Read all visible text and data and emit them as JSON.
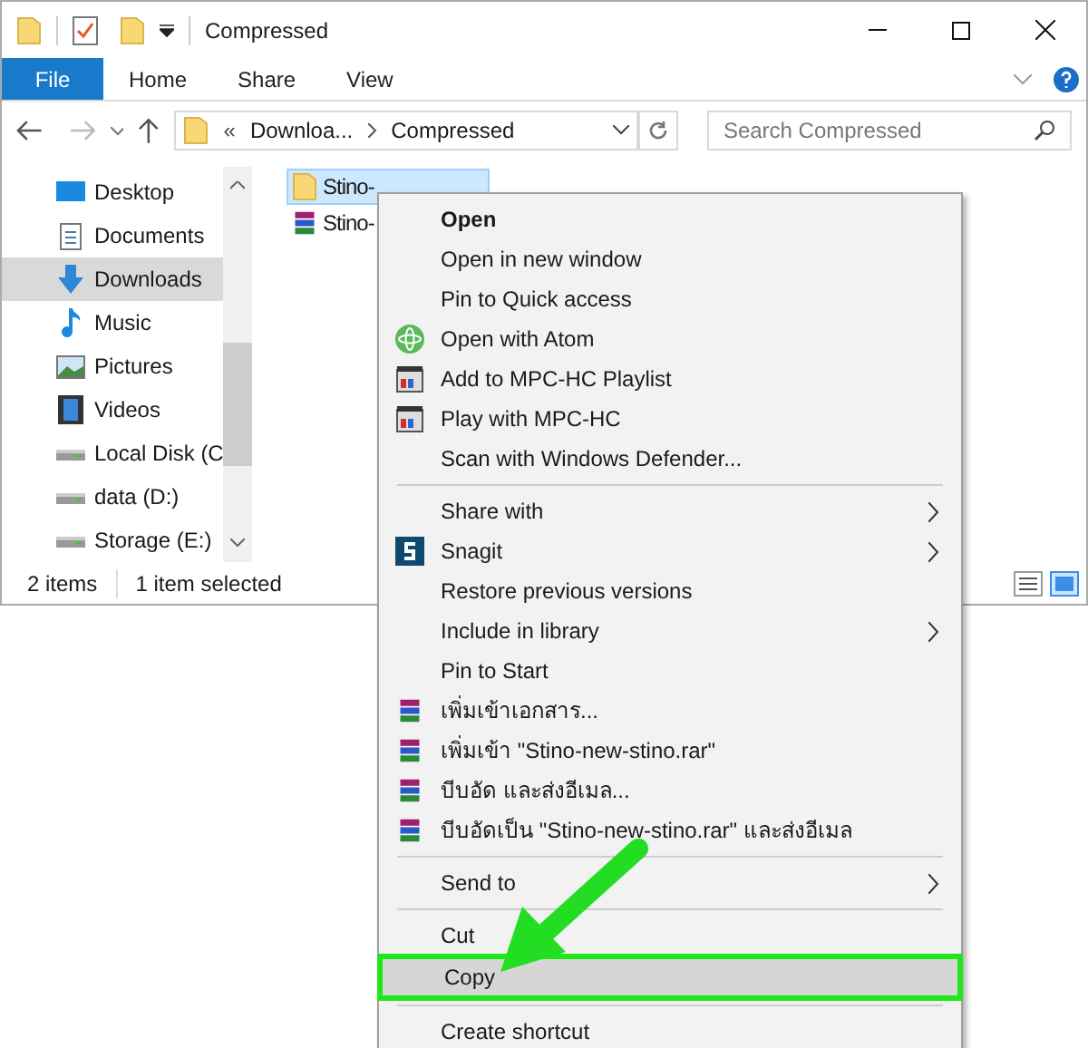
{
  "window": {
    "title": "Compressed"
  },
  "ribbon": {
    "tabs": [
      {
        "label": "File",
        "kind": "file"
      },
      {
        "label": "Home",
        "kind": "tab"
      },
      {
        "label": "Share",
        "kind": "tab"
      },
      {
        "label": "View",
        "kind": "tab"
      }
    ]
  },
  "address": {
    "overflow": "«",
    "crumbs": [
      "Downloa...",
      "Compressed"
    ]
  },
  "search": {
    "placeholder": "Search Compressed"
  },
  "nav": {
    "items": [
      {
        "label": "Desktop",
        "kind": "desktop",
        "selected": false
      },
      {
        "label": "Documents",
        "kind": "documents",
        "selected": false
      },
      {
        "label": "Downloads",
        "kind": "downloads",
        "selected": true
      },
      {
        "label": "Music",
        "kind": "music",
        "selected": false
      },
      {
        "label": "Pictures",
        "kind": "pictures",
        "selected": false
      },
      {
        "label": "Videos",
        "kind": "videos",
        "selected": false
      },
      {
        "label": "Local Disk (C",
        "kind": "drive",
        "selected": false
      },
      {
        "label": "data (D:)",
        "kind": "drive",
        "selected": false
      },
      {
        "label": "Storage (E:)",
        "kind": "drive",
        "selected": false
      }
    ]
  },
  "files": [
    {
      "name": "Stino-",
      "kind": "folder",
      "selected": true
    },
    {
      "name": "Stino-",
      "kind": "archive",
      "selected": false
    }
  ],
  "status_bar": {
    "count": "2 items",
    "selection": "1 item selected"
  },
  "context_menu": {
    "items": [
      {
        "kind": "plain",
        "label": "Open",
        "bold": true,
        "submenu": false,
        "highlighted": false
      },
      {
        "kind": "plain",
        "label": "Open in new window",
        "bold": false,
        "submenu": false,
        "highlighted": false
      },
      {
        "kind": "plain",
        "label": "Pin to Quick access",
        "bold": false,
        "submenu": false,
        "highlighted": false
      },
      {
        "kind": "atom",
        "label": "Open with Atom",
        "bold": false,
        "submenu": false,
        "highlighted": false
      },
      {
        "kind": "mpc",
        "label": "Add to MPC-HC Playlist",
        "bold": false,
        "submenu": false,
        "highlighted": false
      },
      {
        "kind": "mpc",
        "label": "Play with MPC-HC",
        "bold": false,
        "submenu": false,
        "highlighted": false
      },
      {
        "kind": "plain",
        "label": "Scan with Windows Defender...",
        "bold": false,
        "submenu": false,
        "highlighted": false
      },
      {
        "kind": "separator"
      },
      {
        "kind": "plain",
        "label": "Share with",
        "bold": false,
        "submenu": true,
        "highlighted": false
      },
      {
        "kind": "snagit",
        "label": "Snagit",
        "bold": false,
        "submenu": true,
        "highlighted": false
      },
      {
        "kind": "plain",
        "label": "Restore previous versions",
        "bold": false,
        "submenu": false,
        "highlighted": false
      },
      {
        "kind": "plain",
        "label": "Include in library",
        "bold": false,
        "submenu": true,
        "highlighted": false
      },
      {
        "kind": "plain",
        "label": "Pin to Start",
        "bold": false,
        "submenu": false,
        "highlighted": false
      },
      {
        "kind": "archive",
        "label": "เพิ่มเข้าเอกสาร...",
        "bold": false,
        "submenu": false,
        "highlighted": false
      },
      {
        "kind": "archive",
        "label": "เพิ่มเข้า \"Stino-new-stino.rar\"",
        "bold": false,
        "submenu": false,
        "highlighted": false
      },
      {
        "kind": "archive",
        "label": "บีบอัด และส่งอีเมล...",
        "bold": false,
        "submenu": false,
        "highlighted": false
      },
      {
        "kind": "archive",
        "label": "บีบอัดเป็น \"Stino-new-stino.rar\" และส่งอีเมล",
        "bold": false,
        "submenu": false,
        "highlighted": false
      },
      {
        "kind": "separator"
      },
      {
        "kind": "plain",
        "label": "Send to",
        "bold": false,
        "submenu": true,
        "highlighted": false
      },
      {
        "kind": "separator"
      },
      {
        "kind": "plain",
        "label": "Cut",
        "bold": false,
        "submenu": false,
        "highlighted": false
      },
      {
        "kind": "plain",
        "label": "Copy",
        "bold": false,
        "submenu": false,
        "highlighted": true
      },
      {
        "kind": "separator"
      },
      {
        "kind": "plain",
        "label": "Create shortcut",
        "bold": false,
        "submenu": false,
        "highlighted": false
      }
    ]
  }
}
